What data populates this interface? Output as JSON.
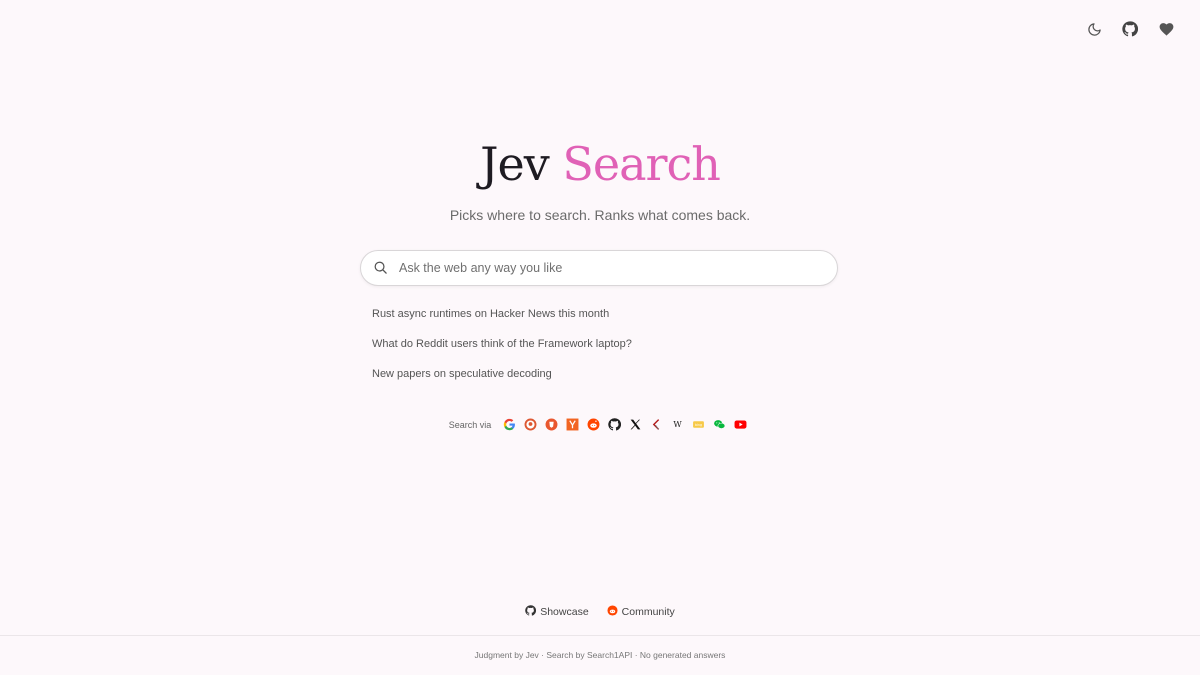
{
  "header": {
    "icons": [
      "moon-icon",
      "github-icon",
      "heart-icon"
    ]
  },
  "hero": {
    "title_part1": "Jev",
    "title_part2": "Search",
    "tagline": "Picks where to search. Ranks what comes back.",
    "accent_color": "#e061b6"
  },
  "search": {
    "placeholder": "Ask the web any way you like",
    "value": ""
  },
  "suggestions": [
    "Rust async runtimes on Hacker News this month",
    "What do Reddit users think of the Framework laptop?",
    "New papers on speculative decoding"
  ],
  "search_via": {
    "label": "Search via",
    "engines": [
      "google-icon",
      "duckduckgo-icon",
      "brave-icon",
      "hacker-news-icon",
      "reddit-icon",
      "github-icon",
      "x-icon",
      "arxiv-icon",
      "wikipedia-icon",
      "bing-icon",
      "wechat-icon",
      "youtube-icon"
    ]
  },
  "footer": {
    "showcase_label": "Showcase",
    "community_label": "Community",
    "credits": "Judgment by Jev · Search by Search1API · No generated answers"
  }
}
